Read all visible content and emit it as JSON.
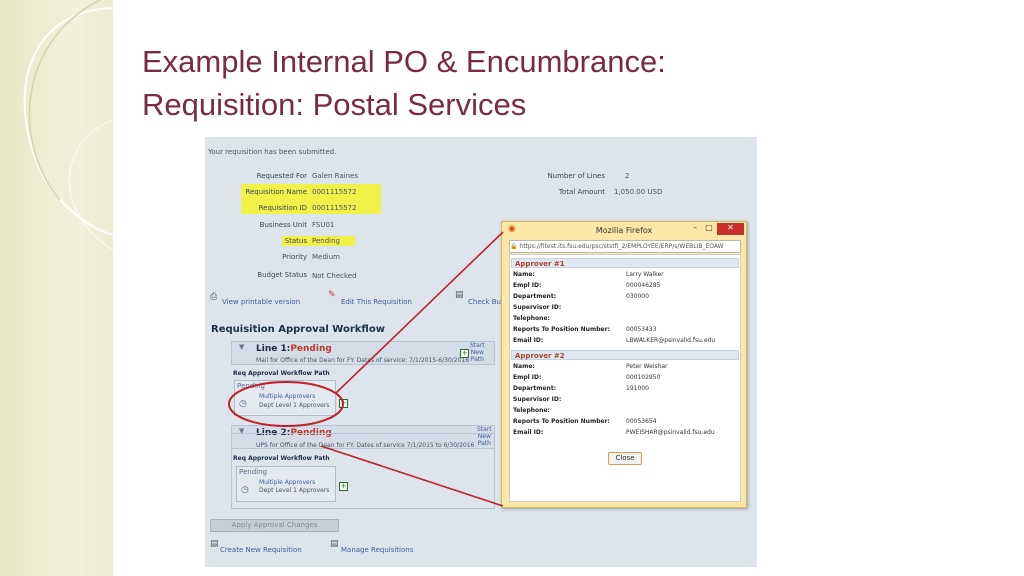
{
  "slide": {
    "title_line1": "Example Internal PO & Encumbrance:",
    "title_line2": "Requisition: Postal Services"
  },
  "requisition": {
    "submitted_msg": "Your requisition has been submitted.",
    "fields": [
      {
        "label": "Requested For",
        "value": "Galen Raines"
      },
      {
        "label": "Requisition Name",
        "value": "0001115572"
      },
      {
        "label": "Requisition ID",
        "value": "0001115572"
      },
      {
        "label": "Business Unit",
        "value": "FSU01"
      },
      {
        "label": "Status",
        "value": "Pending"
      },
      {
        "label": "Priority",
        "value": "Medium"
      },
      {
        "label": "Budget Status",
        "value": "Not Checked"
      }
    ],
    "right_fields": [
      {
        "label": "Number of Lines",
        "value": "2"
      },
      {
        "label": "Total Amount",
        "value": "1,050.00  USD"
      }
    ],
    "links": {
      "view_printable": "View printable version",
      "edit_requisition": "Edit This Requisition",
      "check_budget": "Check Bud",
      "create_new": "Create New Requisition",
      "manage": "Manage Requisitions"
    },
    "apply_button": "Apply Approval Changes"
  },
  "workflow": {
    "title": "Requisition Approval Workflow",
    "lines": [
      {
        "header_prefix": "Line 1:",
        "header_status": "Pending",
        "description": "Mail for Office of the Dean for FY. Dates of service: 7/1/2015-6/30/2016",
        "path_label": "Req Approval Workflow Path",
        "pending": "Pending",
        "approvers_link": "Multiple Approvers",
        "level": "Dept Level 1 Approvers",
        "start_path": [
          "Start",
          "New",
          "Path"
        ]
      },
      {
        "header_prefix": "Line 2:",
        "header_status": "Pending",
        "description": "UPS for Office of the Dean for FY. Dates of service 7/1/2015 to 6/30/2016",
        "path_label": "Req Approval Workflow Path",
        "pending": "Pending",
        "approvers_link": "Multiple Approvers",
        "level": "Dept Level 1 Approvers",
        "start_path": [
          "Start",
          "New",
          "Path"
        ]
      }
    ]
  },
  "popup": {
    "window_title": "Mozilla Firefox",
    "url": "https://fitest.its.fsu.edu/psc/ststfi_2/EMPLOYEE/ERP/s/WEBLIB_EOAW",
    "approvers": [
      {
        "heading": "Approver #1",
        "rows": [
          {
            "label": "Name:",
            "value": "Larry Walker"
          },
          {
            "label": "Empl ID:",
            "value": "000046285"
          },
          {
            "label": "Department:",
            "value": "030000"
          },
          {
            "label": "Supervisor ID:",
            "value": ""
          },
          {
            "label": "Telephone:",
            "value": ""
          },
          {
            "label": "Reports To Position Number:",
            "value": "00053433"
          },
          {
            "label": "Email ID:",
            "value": "LBWALKER@psinvalid.fsu.edu"
          }
        ]
      },
      {
        "heading": "Approver #2",
        "rows": [
          {
            "label": "Name:",
            "value": "Peter Weishar"
          },
          {
            "label": "Empl ID:",
            "value": "000102950"
          },
          {
            "label": "Department:",
            "value": "191000"
          },
          {
            "label": "Supervisor ID:",
            "value": ""
          },
          {
            "label": "Telephone:",
            "value": ""
          },
          {
            "label": "Reports To Position Number:",
            "value": "00053654"
          },
          {
            "label": "Email ID:",
            "value": "PWEISHAR@psinvalid.fsu.edu"
          }
        ]
      }
    ],
    "close_label": "Close"
  }
}
